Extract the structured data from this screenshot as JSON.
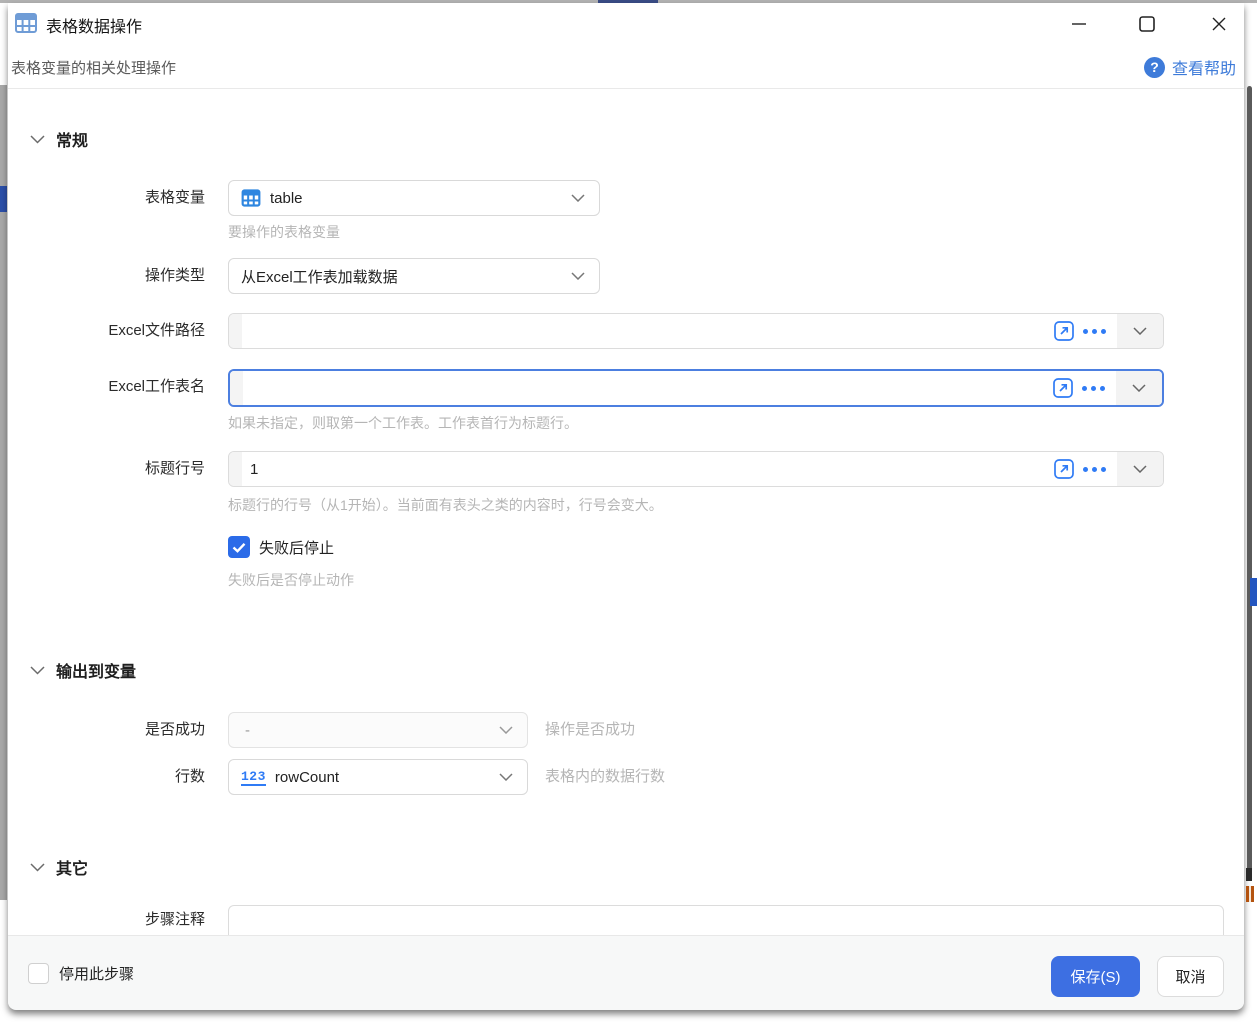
{
  "window": {
    "title": "表格数据操作",
    "subtitle": "表格变量的相关处理操作",
    "help_label": "查看帮助"
  },
  "sections": {
    "general": "常规",
    "output": "输出到变量",
    "other": "其它"
  },
  "fields": {
    "table_var": {
      "label": "表格变量",
      "value": "table",
      "hint": "要操作的表格变量"
    },
    "op_type": {
      "label": "操作类型",
      "value": "从Excel工作表加载数据"
    },
    "excel_path": {
      "label": "Excel文件路径",
      "value": ""
    },
    "excel_sheet": {
      "label": "Excel工作表名",
      "value": "",
      "hint": "如果未指定，则取第一个工作表。工作表首行为标题行。"
    },
    "header_row": {
      "label": "标题行号",
      "value": "1",
      "hint": "标题行的行号（从1开始）。当前面有表头之类的内容时，行号会变大。"
    },
    "stop_on_fail": {
      "label": "失败后停止",
      "hint": "失败后是否停止动作",
      "checked": true
    },
    "success": {
      "label": "是否成功",
      "value": "-",
      "hint": "操作是否成功"
    },
    "row_count": {
      "label": "行数",
      "icon_text": "123",
      "value": "rowCount",
      "hint": "表格内的数据行数"
    },
    "step_comment": {
      "label": "步骤注释",
      "value": ""
    }
  },
  "footer": {
    "disable_step_label": "停用此步骤",
    "save_label": "保存(S)",
    "cancel_label": "取消"
  },
  "colors": {
    "accent_blue": "#3d6fe2",
    "link_blue": "#3e7bd9",
    "icon_blue": "#2f7bf5",
    "checkbox_blue": "#2b6be8",
    "focus_border": "#4c7fe0"
  }
}
